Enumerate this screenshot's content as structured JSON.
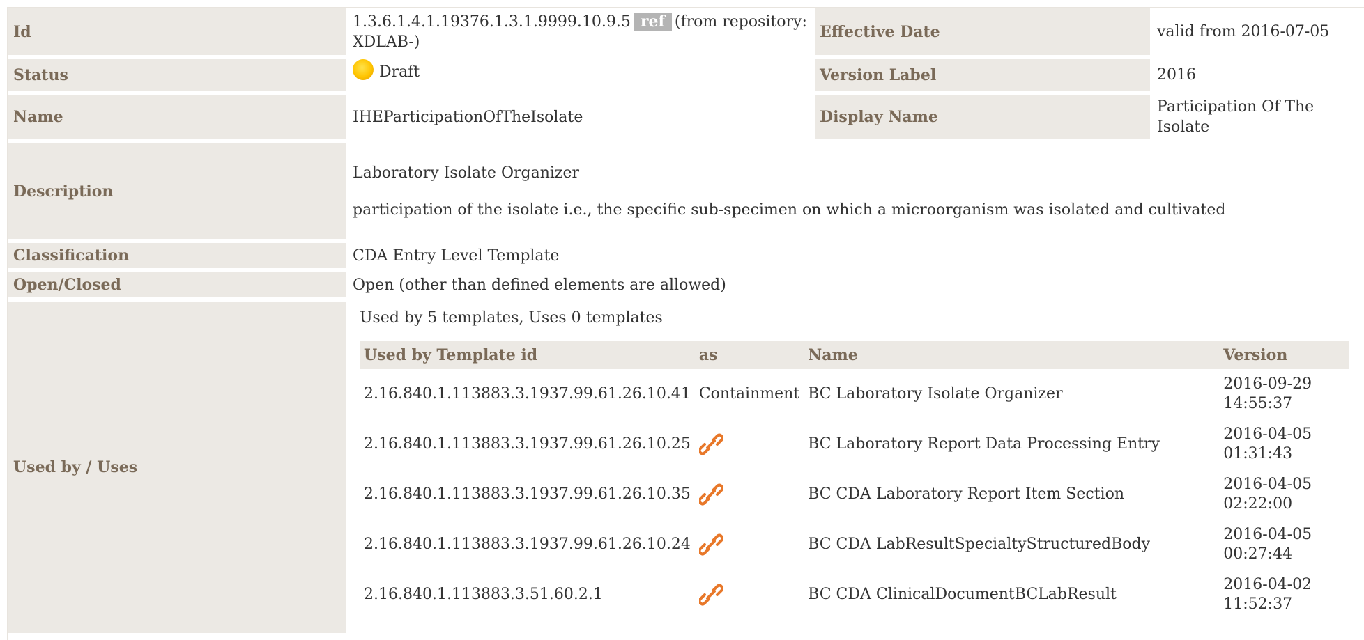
{
  "rows": {
    "id": {
      "label": "Id",
      "oid": "1.3.6.1.4.1.19376.1.3.1.9999.10.9.5",
      "ref_badge": "ref",
      "repo_note_1": "(from repository:",
      "repo_note_2": "XDLAB-)"
    },
    "effective_date": {
      "label": "Effective Date",
      "value": "valid from 2016-07-05"
    },
    "status": {
      "label": "Status",
      "value": "Draft",
      "icon": "draft-status-icon"
    },
    "version_label": {
      "label": "Version Label",
      "value": "2016"
    },
    "name": {
      "label": "Name",
      "value": "IHEParticipationOfTheIsolate"
    },
    "display_name": {
      "label": "Display Name",
      "line1": "Participation Of The",
      "line2": "Isolate"
    },
    "description": {
      "label": "Description",
      "para1": "Laboratory Isolate Organizer",
      "para2": "participation of the isolate i.e., the specific sub-specimen on which a microorganism was isolated and cultivated"
    },
    "classification": {
      "label": "Classification",
      "value": "CDA Entry Level Template"
    },
    "open_closed": {
      "label": "Open/Closed",
      "value": "Open (other than defined elements are allowed)"
    },
    "used_by": {
      "label": "Used by / Uses",
      "summary": "Used by 5 templates, Uses 0 templates",
      "headers": {
        "template_id": "Used by Template id",
        "as": "as",
        "name": "Name",
        "version": "Version"
      },
      "items": [
        {
          "template_id": "2.16.840.1.113883.3.1937.99.61.26.10.41",
          "as": "Containment",
          "name": "BC Laboratory Isolate Organizer",
          "date": "2016-09-29",
          "time": "14:55:37"
        },
        {
          "template_id": "2.16.840.1.113883.3.1937.99.61.26.10.25",
          "as": "",
          "as_icon": "link-icon",
          "name": "BC Laboratory Report Data Processing Entry",
          "date": "2016-04-05",
          "time": "01:31:43"
        },
        {
          "template_id": "2.16.840.1.113883.3.1937.99.61.26.10.35",
          "as": "",
          "as_icon": "link-icon",
          "name": "BC CDA Laboratory Report Item Section",
          "date": "2016-04-05",
          "time": "02:22:00"
        },
        {
          "template_id": "2.16.840.1.113883.3.1937.99.61.26.10.24",
          "as": "",
          "as_icon": "link-icon",
          "name": "BC CDA LabResultSpecialtyStructuredBody",
          "date": "2016-04-05",
          "time": "00:27:44"
        },
        {
          "template_id": "2.16.840.1.113883.3.51.60.2.1",
          "as": "",
          "as_icon": "link-icon",
          "name": "BC CDA ClinicalDocumentBCLabResult",
          "date": "2016-04-02",
          "time": "11:52:37"
        }
      ]
    }
  },
  "colors": {
    "label_bg": "#ece9e4",
    "label_text": "#7a6a58",
    "ref_badge_bg": "#b4b4b4",
    "link_icon": "#e8782a",
    "status_draft": "#ffc400"
  }
}
